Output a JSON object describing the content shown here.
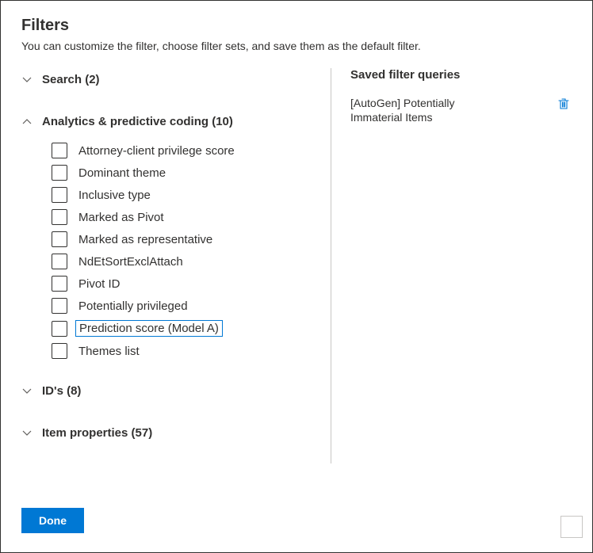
{
  "title": "Filters",
  "subtitle": "You can customize the filter, choose filter sets, and save them as the default filter.",
  "sections": {
    "search": {
      "label": "Search (2)"
    },
    "analytics": {
      "label": "Analytics & predictive coding (10)",
      "items": [
        "Attorney-client privilege score",
        "Dominant theme",
        "Inclusive type",
        "Marked as Pivot",
        "Marked as representative",
        "NdEtSortExclAttach",
        "Pivot ID",
        "Potentially privileged",
        "Prediction score (Model A)",
        "Themes list"
      ],
      "highlight_index": 8
    },
    "ids": {
      "label": "ID's (8)"
    },
    "item_props": {
      "label": "Item properties (57)"
    }
  },
  "saved": {
    "title": "Saved filter queries",
    "rows": [
      {
        "name": "[AutoGen] Potentially Immaterial Items"
      }
    ]
  },
  "buttons": {
    "done": "Done"
  }
}
